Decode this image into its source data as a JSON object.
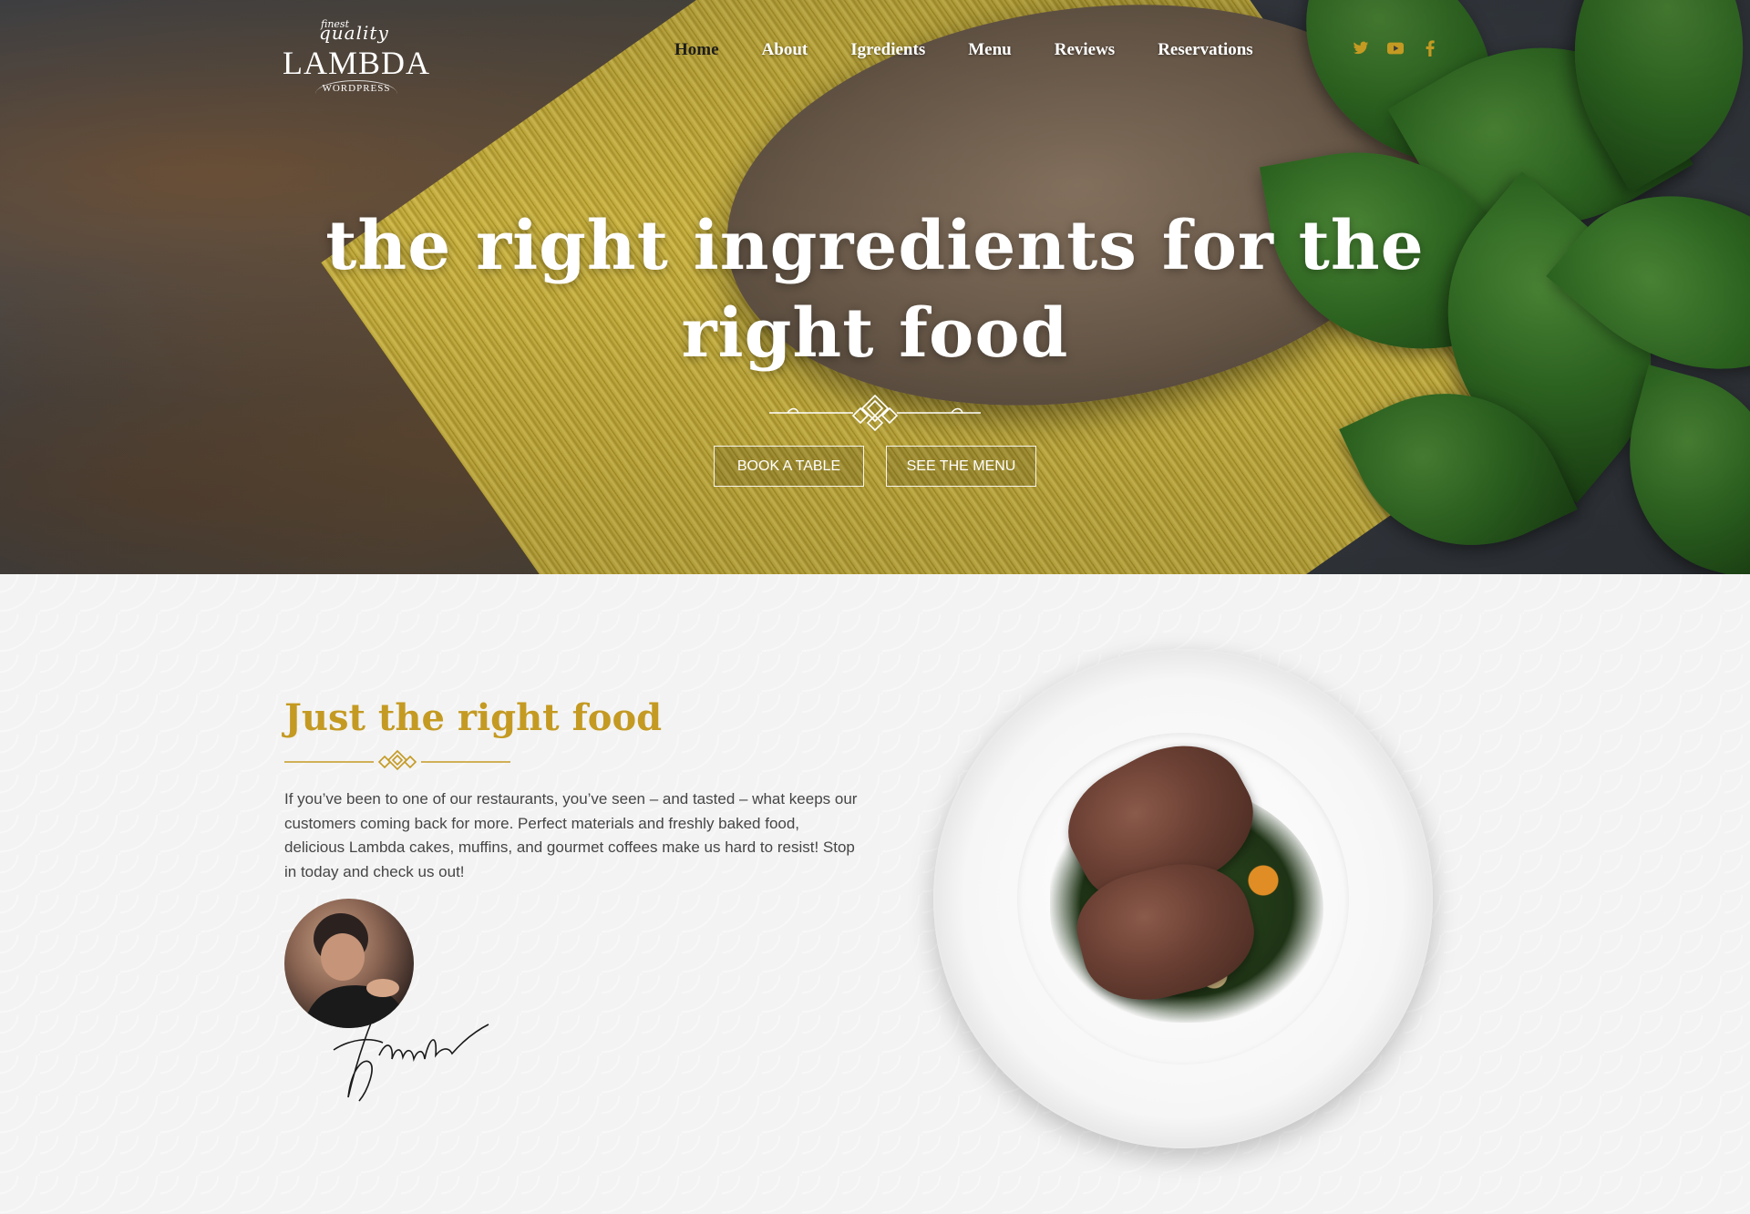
{
  "logo": {
    "finest": "finest",
    "quality": "quality",
    "brand": "LAMBDA",
    "sub": "WORDPRESS"
  },
  "nav": {
    "items": [
      {
        "label": "Home",
        "active": true
      },
      {
        "label": "About",
        "active": false
      },
      {
        "label": "Igredients",
        "active": false
      },
      {
        "label": "Menu",
        "active": false
      },
      {
        "label": "Reviews",
        "active": false
      },
      {
        "label": "Reservations",
        "active": false
      }
    ]
  },
  "social": {
    "icons": [
      "twitter-icon",
      "youtube-icon",
      "facebook-icon"
    ],
    "color": "#c49a22"
  },
  "hero": {
    "headline_line1": "the right ingredients for the",
    "headline_line2": "right food",
    "book_label": "BOOK A TABLE",
    "menu_label": "SEE THE MENU"
  },
  "about": {
    "title": "Just the right food",
    "text": "If you’ve been to one of our restaurants, you’ve seen – and tasted – what keeps our customers coming back for more. Perfect materials and freshly baked food, delicious Lambda cakes, muffins, and gourmet coffees make us hard to resist! Stop in today and check us out!",
    "accent_color": "#c49a22"
  }
}
